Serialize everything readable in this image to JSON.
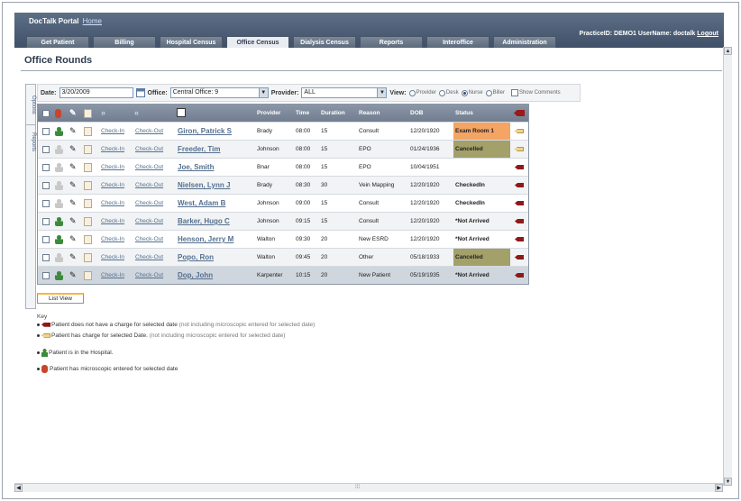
{
  "header": {
    "brand": "DocTalk Portal",
    "home_link": "Home",
    "practice_label": "PracticeID: DEMO1",
    "user_label": "UserName: doctalk",
    "logout": "Logout"
  },
  "tabs": [
    "Get Patient",
    "Billing",
    "Hospital Census",
    "Office Census",
    "Dialysis Census",
    "Reports",
    "Interoffice",
    "Administration"
  ],
  "active_tab": "Office Census",
  "page_title": "Office Rounds",
  "side_tabs": {
    "options": "Options",
    "reports": "Reports"
  },
  "filters": {
    "date_label": "Date:",
    "date_value": "3/20/2009",
    "office_label": "Office:",
    "office_value": "Central Office: 9",
    "provider_label": "Provider:",
    "provider_value": "ALL",
    "view_label": "View:",
    "view_options": [
      "Provider",
      "Desk",
      "Nurse",
      "Biller"
    ],
    "view_selected": "Nurse",
    "show_comments": "Show Comments"
  },
  "columns": {
    "provider": "Provider",
    "time": "Time",
    "duration": "Duration",
    "reason": "Reason",
    "dob": "DOB",
    "status": "Status"
  },
  "rows": [
    {
      "checkin": "Check-In",
      "checkout": "Check-Out",
      "name": "Giron, Patrick S",
      "provider": "Brady",
      "time": "08:00",
      "duration": "15",
      "reason": "Consult",
      "dob": "12/20/1920",
      "status": "Exam Room 1",
      "flag": "tan",
      "in_hospital": true
    },
    {
      "checkin": "Check-In",
      "checkout": "Check-Out",
      "name": "Freeder, Tim",
      "provider": "Johnson",
      "time": "08:00",
      "duration": "15",
      "reason": "EPO",
      "dob": "01/24/1936",
      "status": "Cancelled",
      "flag": "tan",
      "in_hospital": false
    },
    {
      "checkin": "Check-In",
      "checkout": "Check-Out",
      "name": "Joe, Smith",
      "provider": "Bnar",
      "time": "08:00",
      "duration": "15",
      "reason": "EPO",
      "dob": "10/04/1951",
      "status": "",
      "flag": "red",
      "in_hospital": false
    },
    {
      "checkin": "Check-In",
      "checkout": "Check-Out",
      "name": "Nielsen, Lynn J",
      "provider": "Brady",
      "time": "08:30",
      "duration": "30",
      "reason": "Vein Mapping",
      "dob": "12/20/1920",
      "status": "CheckedIn",
      "flag": "red",
      "in_hospital": false
    },
    {
      "checkin": "Check-In",
      "checkout": "Check-Out",
      "name": "West, Adam B",
      "provider": "Johnson",
      "time": "09:00",
      "duration": "15",
      "reason": "Consult",
      "dob": "12/20/1920",
      "status": "CheckedIn",
      "flag": "red",
      "in_hospital": false
    },
    {
      "checkin": "Check-In",
      "checkout": "Check-Out",
      "name": "Barker, Hugo C",
      "provider": "Johnson",
      "time": "09:15",
      "duration": "15",
      "reason": "Consult",
      "dob": "12/20/1920",
      "status": "*Not Arrived",
      "flag": "red",
      "in_hospital": true
    },
    {
      "checkin": "Check-In",
      "checkout": "Check-Out",
      "name": "Henson, Jerry M",
      "provider": "Walton",
      "time": "09:30",
      "duration": "20",
      "reason": "New ESRD",
      "dob": "12/20/1920",
      "status": "*Not Arrived",
      "flag": "red",
      "in_hospital": true
    },
    {
      "checkin": "Check-In",
      "checkout": "Check-Out",
      "name": "Popo, Ron",
      "provider": "Walton",
      "time": "09:45",
      "duration": "20",
      "reason": "Other",
      "dob": "05/18/1933",
      "status": "Cancelled",
      "flag": "red",
      "in_hospital": false
    },
    {
      "checkin": "Check-In",
      "checkout": "Check-Out",
      "name": "Dop, John",
      "provider": "Karpenter",
      "time": "10:15",
      "duration": "20",
      "reason": "New Patient",
      "dob": "05/19/1935",
      "status": "*Not Arrived",
      "flag": "red",
      "in_hospital": true
    }
  ],
  "list_view": "List View",
  "key": {
    "title": "Key",
    "no_charge": "Patient does not have a charge for selected date",
    "no_charge_note": "(not including microscopic entered for selected date)",
    "has_charge": "Patient has charge for selected Date.",
    "has_charge_note": "(not including microscopic entered for selected date)",
    "in_hospital": "Patient is in the Hospital.",
    "microscopic": "Patient has microscopic entered for selected date"
  },
  "colors": {
    "header": "#4c5d75",
    "exam_room": "#f4a463",
    "cancelled": "#a3a06a",
    "flag_red": "#8b1a1a",
    "flag_tan": "#efd48a"
  }
}
